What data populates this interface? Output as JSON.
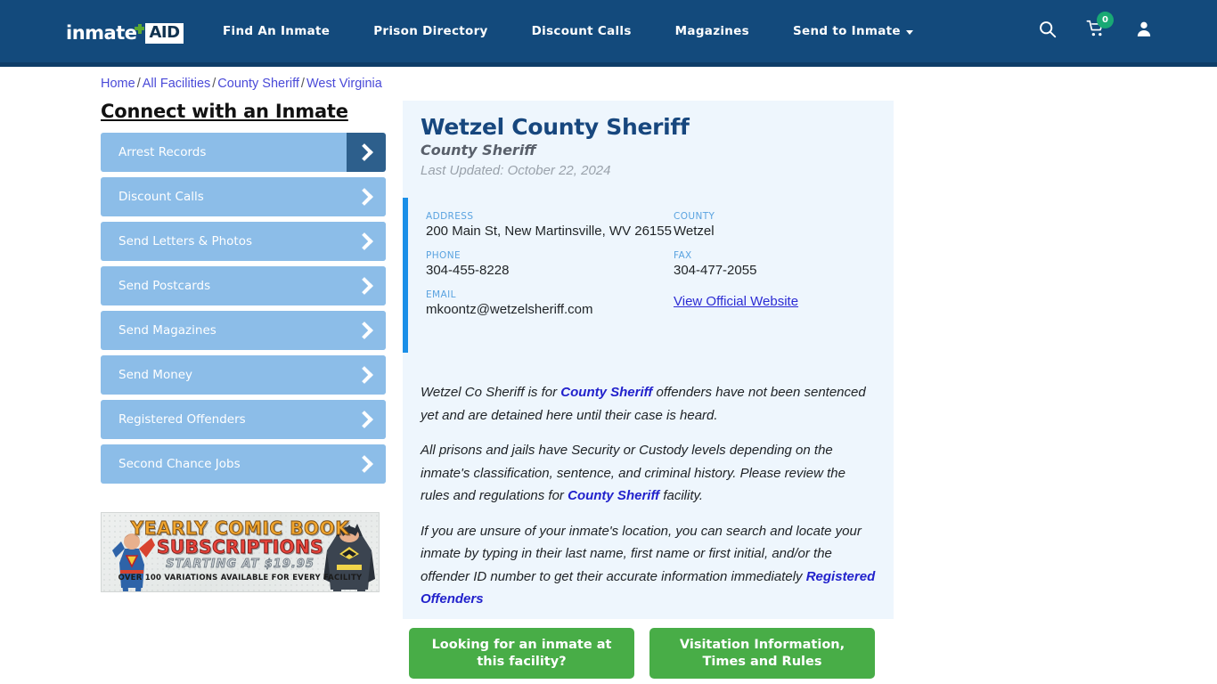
{
  "header": {
    "logo": {
      "word": "inmate",
      "box": "AID",
      "icon": "green-cross"
    },
    "nav": [
      {
        "label": "Find An Inmate",
        "dropdown": false
      },
      {
        "label": "Prison Directory",
        "dropdown": false
      },
      {
        "label": "Discount Calls",
        "dropdown": false
      },
      {
        "label": "Magazines",
        "dropdown": false
      },
      {
        "label": "Send to Inmate",
        "dropdown": true
      }
    ],
    "icons": {
      "search": "search-icon",
      "cart": "shopping-cart-icon",
      "cart_badge": "0",
      "account": "user-account-icon"
    },
    "bg_color": "#134a7c",
    "badge_color": "#19a974"
  },
  "breadcrumb": {
    "items": [
      "Home",
      "All Facilities",
      "County Sheriff",
      "West Virginia"
    ],
    "separator": "/",
    "link_color": "#4a4ad8"
  },
  "sidebar": {
    "title": "Connect with an Inmate",
    "items": [
      {
        "label": "Arrest Records",
        "active": true
      },
      {
        "label": "Discount Calls",
        "active": false
      },
      {
        "label": "Send Letters & Photos",
        "active": false
      },
      {
        "label": "Send Postcards",
        "active": false
      },
      {
        "label": "Send Magazines",
        "active": false
      },
      {
        "label": "Send Money",
        "active": false
      },
      {
        "label": "Registered Offenders",
        "active": false
      },
      {
        "label": "Second Chance Jobs",
        "active": false
      }
    ],
    "button_color": "#8cbde8",
    "active_arrow_color": "#2d5f8c"
  },
  "ad": {
    "line1": "YEARLY COMIC BOOK",
    "line2": "SUBSCRIPTIONS",
    "line3": "STARTING AT $19.95",
    "line4": "OVER 100 VARIATIONS AVAILABLE FOR EVERY FACILITY"
  },
  "facility": {
    "title": "Wetzel County Sheriff",
    "subtitle": "County Sheriff",
    "last_updated": "Last Updated: October 22, 2024",
    "info": {
      "address_label": "ADDRESS",
      "address_value": "200 Main St, New Martinsville, WV 26155",
      "county_label": "COUNTY",
      "county_value": "Wetzel",
      "phone_label": "PHONE",
      "phone_value": "304-455-8228",
      "fax_label": "FAX",
      "fax_value": "304-477-2055",
      "email_label": "EMAIL",
      "email_value": "mkoontz@wetzelsheriff.com",
      "website_link": "View Official Website"
    },
    "paragraphs": {
      "p1_a": "Wetzel Co Sheriff is for ",
      "p1_link": "County Sheriff",
      "p1_b": " offenders have not been sentenced yet and are detained here until their case is heard.",
      "p2_a": "All prisons and jails have Security or Custody levels depending on the inmate's classification, sentence, and criminal history. Please review the rules and regulations for ",
      "p2_link": "County Sheriff",
      "p2_b": " facility.",
      "p3_a": "If you are unsure of your inmate's location, you can search and locate your inmate by typing in their last name, first name or first initial, and/or the offender ID number to get their accurate information immediately ",
      "p3_link": "Registered Offenders"
    },
    "panel_bg": "#eef6fd",
    "accent_color": "#1a8fe8",
    "title_color": "#17477e"
  },
  "cta": {
    "buttons": [
      "Looking for an inmate at this facility?",
      "Visitation Information, Times and Rules"
    ],
    "color": "#48ad47"
  }
}
